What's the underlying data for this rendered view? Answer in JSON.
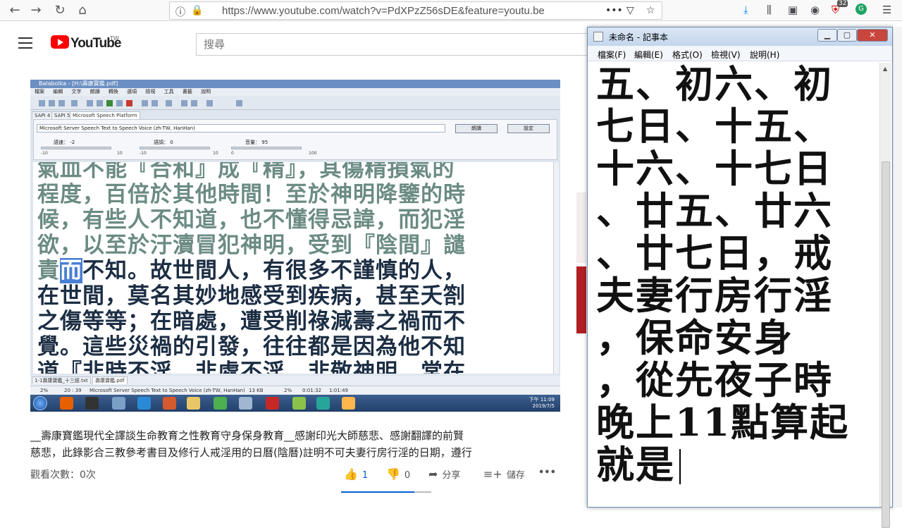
{
  "browser": {
    "url": "https://www.youtube.com/watch?v=PdXPzZ56sDE&feature=youtu.be",
    "notification_count": "32",
    "icons": [
      "back-icon",
      "forward-icon",
      "reload-icon",
      "home-icon",
      "info-icon",
      "lock-icon",
      "more-icon",
      "pocket-icon",
      "star-icon",
      "download-icon",
      "library-icon",
      "sidebar-icon",
      "sync-icon",
      "extension-icon",
      "extension-icon-2",
      "menu-icon"
    ]
  },
  "youtube": {
    "logo_text": "YouTube",
    "region": "TW",
    "search_placeholder": "搜尋",
    "description_line1": "__壽康寶鑑現代全譯談生命教育之性教育守身保身教育__感謝印光大師慈悲、感謝翻譯的前賢",
    "description_line2": "慈悲，此錄影合三教參考書目及修行人戒淫用的日曆(陰曆)註明不可夫妻行房行淫的日期，遵行",
    "views": "觀看次數：0次",
    "like_count": "1",
    "dislike_count": "0",
    "share_label": "分享",
    "save_label": "儲存",
    "accent_color": "#065fd4",
    "brand_color": "#ff0000"
  },
  "balabolka": {
    "title": "Balabolka - [H:\\壽康寶鑑.pdf]",
    "menu": [
      "檔案",
      "編輯",
      "文字",
      "朗讀",
      "轉換",
      "選項",
      "檢視",
      "工具",
      "書籤",
      "說明"
    ],
    "tabs": [
      "SAPI 4",
      "SAPI 5",
      "Microsoft Speech Platform"
    ],
    "voice": "Microsoft Server Speech Text to Speech Voice (zh-TW, HanHan)",
    "btn_read": "朗讀",
    "btn_settings": "設定",
    "rate_label": "語速：",
    "rate_value": "-2",
    "pitch_label": "語調：",
    "pitch_value": "0",
    "volume_label": "音量：",
    "volume_value": "95",
    "scale_min1": "-10",
    "scale_max1": "10",
    "scale_min2": "-10",
    "scale_max2": "10",
    "scale_min3": "0",
    "scale_max3": "100",
    "text_lines": [
      "氣血不能『合和』成『精』，其傷精損氣的",
      "程度，百倍於其他時間！至於神明降鑒的時",
      "候，有些人不知道，也不懂得忌諱，而犯淫",
      "欲，以至於汙瀆冒犯神明，受到『陰間』譴"
    ],
    "highlight_line_pre": "責",
    "highlight_word": "而",
    "highlight_line_post": "不知。故世間人，有很多不謹慎的人，",
    "text_lines_dark": [
      "在世間，莫名其妙地感受到疾病，甚至夭劄",
      "之傷等等；在暗處，遭受削祿減壽之禍而不",
      "覺。這些災禍的引發，往往都是因為他不知",
      "道『非時不淫，非處不淫，非敬神明，常在"
    ],
    "doc_tabs": [
      "1-1壽康寶鑑_十三經.txt",
      "壽康寶鑑.pdf"
    ],
    "status_percent": "2%",
    "status_pos": "20 : 39",
    "status_voice": "Microsoft Server Speech Text to Speech Voice (zh-TW, HanHan)",
    "status_size": "13 KB",
    "status_percent2": "2%",
    "status_elapsed": "0:01:32",
    "status_total": "1:01:49",
    "clock_time": "下午 11:09",
    "clock_date": "2019/7/5"
  },
  "notepad": {
    "title": "未命名 - 記事本",
    "menu": [
      "檔案(F)",
      "編輯(E)",
      "格式(O)",
      "檢視(V)",
      "說明(H)"
    ],
    "lines": [
      "五、初六、初",
      "七日、十五、",
      "十六、十七日",
      "、廿五、廿六",
      "、廿七日，戒",
      "夫妻行房行淫",
      "，保命安身",
      "，從先夜子時",
      "晚上11點算起",
      "就是"
    ]
  }
}
